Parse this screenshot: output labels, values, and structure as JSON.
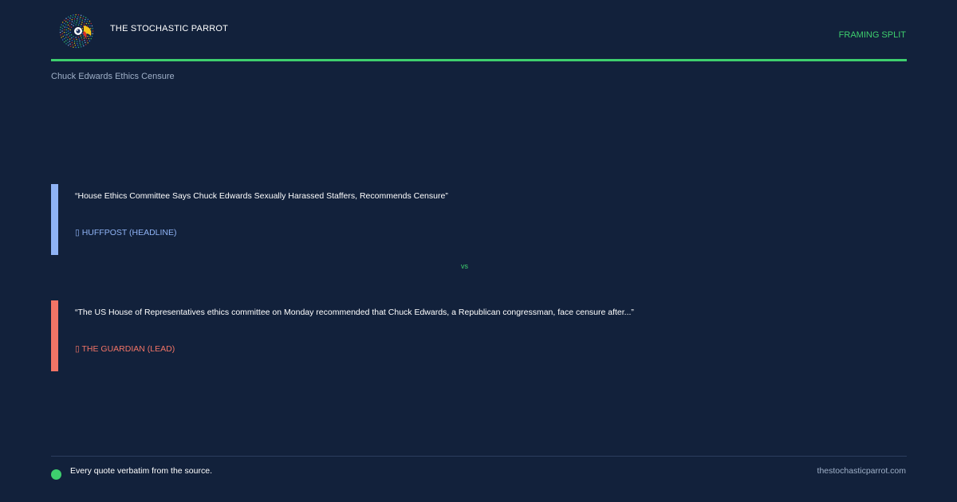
{
  "header": {
    "brand": "THE STOCHASTIC PARROT",
    "tag": "FRAMING SPLIT",
    "logo_icon": "parrot-icon"
  },
  "topic": "Chuck Edwards Ethics Censure",
  "quotes": [
    {
      "text": "“House Ethics Committee Says Chuck Edwards Sexually Harassed Staffers, Recommends Censure”",
      "source": "▯ HUFFPOST (HEADLINE)",
      "color": "#8fb3f5"
    },
    {
      "text": "“The US House of Representatives ethics committee on Monday recommended that Chuck Edwards, a Republican congressman, face censure after...”",
      "source": "▯ THE GUARDIAN (LEAD)",
      "color": "#f27466"
    }
  ],
  "vs": "vs",
  "footer": {
    "note": "Every quote verbatim from the source.",
    "site": "thestochasticparrot.com"
  },
  "colors": {
    "background": "#12213b",
    "accent": "#3ecf6e"
  }
}
